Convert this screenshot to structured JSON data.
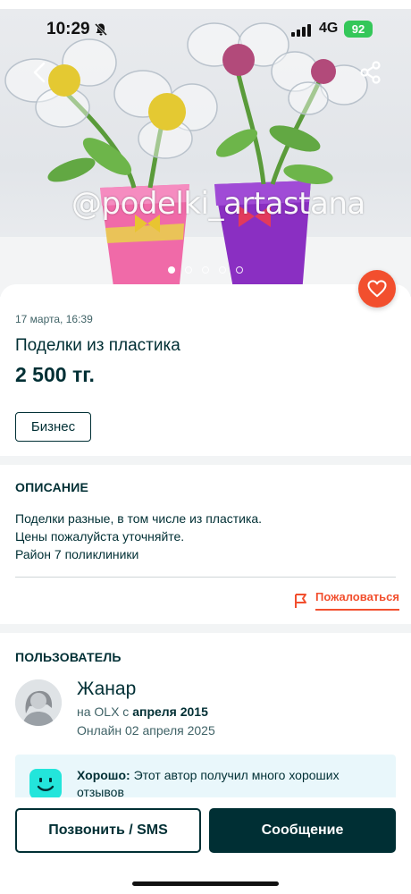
{
  "status_bar": {
    "time": "10:29",
    "network": "4G",
    "battery": "92"
  },
  "gallery": {
    "watermark": "@podelki_artastana",
    "image_count": 5,
    "active_index": 0
  },
  "listing": {
    "date": "17 марта, 16:39",
    "title": "Поделки из пластика",
    "price": "2 500 тг.",
    "tag": "Бизнес"
  },
  "description": {
    "heading": "ОПИСАНИЕ",
    "lines": [
      "Поделки разные, в том числе из пластика.",
      "Цены пожалуйста уточняйте.",
      "Район 7 поликлиники"
    ],
    "report_label": "Пожаловаться"
  },
  "user": {
    "heading": "ПОЛЬЗОВАТЕЛЬ",
    "name": "Жанар",
    "since_prefix": "на OLX с",
    "since_date": "апреля 2015",
    "online": "Онлайн 02 апреля 2025",
    "rating_label": "Хорошо:",
    "rating_text": "Этот автор получил много хороших отзывов"
  },
  "actions": {
    "call_label": "Позвонить / SMS",
    "message_label": "Сообщение"
  },
  "colors": {
    "brand_dark": "#002f34",
    "accent": "#f24f2e",
    "rating_bg": "#e9f7fb",
    "battery": "#34c759"
  },
  "icons": [
    "back-arrow-icon",
    "share-icon",
    "heart-icon",
    "flag-icon",
    "smiley-icon",
    "bell-slash-icon",
    "signal-icon"
  ]
}
